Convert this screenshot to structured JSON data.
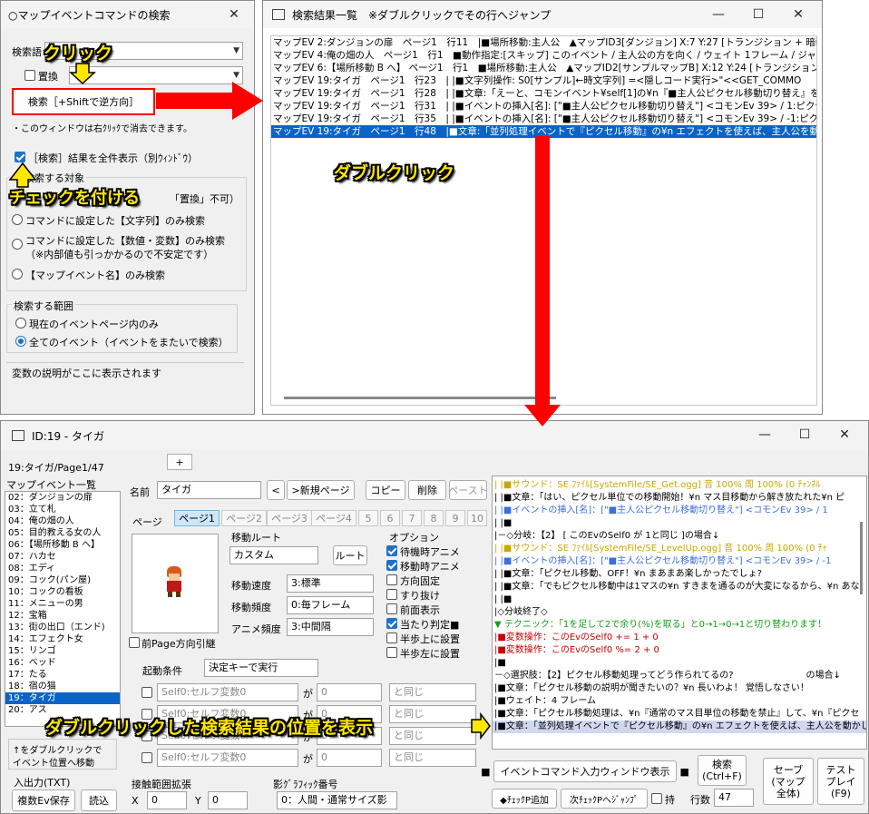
{
  "search_win": {
    "title": "○マップイベントコマンドの検索",
    "close": "✕",
    "search_label": "検索語",
    "replace_label": "置換",
    "search_button": "検索［+Shiftで逆方向］",
    "note": "・このウィンドウは右ｸﾘｯｸで消去できます。",
    "show_all_label": "［検索］結果を全件表示（別ｳｨﾝﾄﾞｳ）",
    "target_group": "検索する対象",
    "target_opt0": "「置換」不可）",
    "target_opt1": "コマンドに設定した【文字列】のみ検索",
    "target_opt2a": "コマンドに設定した【数値・変数】のみ検索",
    "target_opt2b": "（※内部値も引っかかるので不安定です）",
    "target_opt3": "【マップイベント名】のみ検索",
    "range_group": "検索する範囲",
    "range_opt1": "現在のイベントページ内のみ",
    "range_opt2": "全てのイベント（イベントをまたいで検索）",
    "desc": "変数の説明がここに表示されます"
  },
  "results_win": {
    "title": "検索結果一覧　※ダブルクリックでその行へジャンプ",
    "min": "—",
    "max": "☐",
    "close": "✕",
    "rows": [
      "マップEV 2:ダンジョンの扉　ページ1　行11　|■場所移動:主人公　▲マップID3[ダンジョン] X:7 Y:27 [トランジション + 暗転有り",
      "マップEV 4:俺の畑の人　ページ1　行1　■動作指定:[スキップ] このイベント / 主人公の方を向く / ウェイト 1フレーム / ジャンプ",
      "マップEV 6:【場所移動 B へ】 ページ1　行1　■場所移動:主人公　▲マップID2[サンプルマップB] X:12 Y:24 [トランジション + 暗",
      "マップEV 19:タイガ　ページ1　行23　| |■文字列操作: S0[サンプル]←時文字列] =<隠しコード実行>\"<<GET_COMMO",
      "マップEV 19:タイガ　ページ1　行28　| |■文章:「えーと、コモンイベント¥self[1]の¥n『■主人公ピクセル移動切り替え』を.....¥",
      "マップEV 19:タイガ　ページ1　行31　| |■イベントの挿入[名]: [\"■主人公ピクセル移動切り替え\"] <コモンEv 39> / 1:ピクセ",
      "マップEV 19:タイガ　ページ1　行35　| |■イベントの挿入[名]: [\"■主人公ピクセル移動切り替え\"] <コモンEv 39> / -1:ピク",
      "マップEV 19:タイガ　ページ1　行48　|■文章:「並列処理イベントで『ピクセル移動』の¥n エフェクトを使えば、主人公を動かして"
    ]
  },
  "editor_win": {
    "title": "ID:19 - タイガ",
    "min": "—",
    "max": "☐",
    "close": "✕",
    "page_label": "19:タイガ/Page1/47",
    "add_tab": "+",
    "list_header": "マップイベント一覧",
    "events": [
      "02：ダンジョンの扉",
      "03：立て札",
      "04：俺の畑の人",
      "05：目的教える女の人",
      "06：【場所移動 B へ】",
      "07：ハカセ",
      "08：エディ",
      "09：コック(パン屋)",
      "10：コックの看板",
      "11：メニューの男",
      "12：宝箱",
      "13：街の出口（エンド)",
      "14：エフェクト女",
      "15：リンゴ",
      "16：ベッド",
      "17：たる",
      "18：宿の猫",
      "19：タイガ",
      "20：アス"
    ],
    "list_note1": "↑をダブルクリックで",
    "list_note2": "イベント位置へ移動",
    "io_label": "入出力(TXT)",
    "multi_save": "複数Ev保存",
    "load": "読込",
    "name_label": "名前",
    "name_value": "タイガ",
    "prev": "<",
    "new_page": ">新規ページ",
    "copy": "コピー",
    "delete": "削除",
    "paste": "ペースト",
    "page_tab_label": "ページ",
    "tabs": [
      "ページ1",
      "ページ2",
      "ページ3",
      "ページ4",
      "5",
      "6",
      "7",
      "8",
      "9",
      "10"
    ],
    "prev_dir": "前Page方向引継",
    "move_route": "移動ルート",
    "move_route_value": "カスタム",
    "route_button": "ルート",
    "speed_label": "移動速度",
    "speed_value": "3:標準",
    "freq_label": "移動頻度",
    "freq_value": "0:毎フレーム",
    "anim_label": "アニメ頻度",
    "anim_value": "3:中間隔",
    "options_label": "オプション",
    "options": [
      {
        "label": "待機時アニメ",
        "checked": true
      },
      {
        "label": "移動時アニメ",
        "checked": true
      },
      {
        "label": "方向固定",
        "checked": false
      },
      {
        "label": "すり抜け",
        "checked": false
      },
      {
        "label": "前面表示",
        "checked": false
      },
      {
        "label": "当たり判定■",
        "checked": true
      },
      {
        "label": "半歩上に設置",
        "checked": false
      },
      {
        "label": "半歩左に設置",
        "checked": false
      }
    ],
    "trigger_label": "起動条件",
    "trigger_value": "決定キーで実行",
    "cond_var": "Self0:セルフ変数0",
    "cond_ga": "が",
    "cond_num": "0",
    "cond_op": "と同じ",
    "contact_label": "接触範囲拡張",
    "contact_x": "X",
    "contact_y": "Y",
    "contact_xv": "0",
    "contact_yv": "0",
    "gfx_label": "影ｸﾞﾗﾌｨｯｸ番号",
    "gfx_value": "0：人間・通常サイズ影",
    "cmd_lines": [
      {
        "t": "| |■サウンド：SE ﾌｧｲﾙ[SystemFile/SE_Get.ogg] 音 100% 周 100% (0 ﾁｬﾝﾈﾙ",
        "c": "#c8a800"
      },
      {
        "t": "| |■文章：「はい、ピクセル単位での移動開始！¥n マス目移動から解き放たれた¥n ピ",
        "c": "#000000"
      },
      {
        "t": "| |■イベントの挿入[名]：[\"■主人公ピクセル移動切り替え\"] <コモンEv 39>  / 1",
        "c": "#3c6ee0"
      },
      {
        "t": "| |■",
        "c": "#000000"
      },
      {
        "t": "|－◇分岐：【2】 [ このEvのSelf0 が 1と同じ ]の場合↓",
        "c": "#000000"
      },
      {
        "t": "| |■サウンド：SE ﾌｧｲﾙ[SystemFile/SE_LevelUp.ogg] 音 100% 周 100% (0 ﾁｬ",
        "c": "#c8a800"
      },
      {
        "t": "| |■イベントの挿入[名]：[\"■主人公ピクセル移動切り替え\"] <コモンEv 39>  / -1",
        "c": "#3c6ee0"
      },
      {
        "t": "| |■文章：「ピクセル移動、OFF！¥n まあまあ楽しかったでしょ?",
        "c": "#000000"
      },
      {
        "t": "| |■文章：「でもピクセル移動中は1マスの¥n すきまを通るのが大変になるから、¥n あな",
        "c": "#000000"
      },
      {
        "t": "| |■",
        "c": "#000000"
      },
      {
        "t": "|◇分岐終了◇",
        "c": "#000000"
      },
      {
        "t": "▼ テクニック：「1を足して2で余り(%)を取る」と0→1→0→1と切り替わります！",
        "c": "#14a014"
      },
      {
        "t": "|■変数操作：このEvのSelf0 += 1 + 0",
        "c": "#c80000"
      },
      {
        "t": "|■変数操作：このEvのSelf0 %= 2 + 0",
        "c": "#c80000"
      },
      {
        "t": "|■",
        "c": "#000000"
      },
      {
        "t": "－◇選択肢：【2】ピクセル移動処理ってどう作られてるの?　　　　　　　　の場合↓",
        "c": "#000000"
      },
      {
        "t": "|■文章：「ピクセル移動の説明が聞きたいの？¥n 長いわよ！ 覚悟しなさい！",
        "c": "#000000"
      },
      {
        "t": "|■ウェイト：4 フレーム",
        "c": "#000000"
      },
      {
        "t": "|■文章：「ピクセル移動処理は、¥n『通常のマス目単位の移動を禁止』して、¥n『ピクセ",
        "c": "#000000"
      },
      {
        "t": "|■文章：「並列処理イベントで『ピクセル移動』の¥n エフェクトを使えば、主人公を動かして",
        "c": "#000000"
      }
    ],
    "cmd_input": "■　イベントコマンド入力ウィンドウ表示　■",
    "search_btn_l1": "検索",
    "search_btn_l2": "(Ctrl+F)",
    "save_l1": "セーブ",
    "save_l2": "(マップ",
    "save_l3": "全体)",
    "test_l1": "テスト",
    "test_l2": "プレイ",
    "test_l3": "(F9)",
    "checkp_add": "◆ﾁｪｯｸP追加",
    "checkp_jump": "次ﾁｪｯｸPへｼﾞｬﾝﾌﾟ",
    "hold": "持",
    "lines_label": "行数",
    "lines_value": "47"
  },
  "annotations": {
    "click": "クリック",
    "check": "チェックを付ける",
    "dblclick": "ダブルクリック",
    "show_pos": "ダブルクリックした検索結果の位置を表示"
  },
  "colors": {
    "arrow": "#ff0000",
    "highlight": "#0a64c8",
    "annot": "#ffe800"
  }
}
